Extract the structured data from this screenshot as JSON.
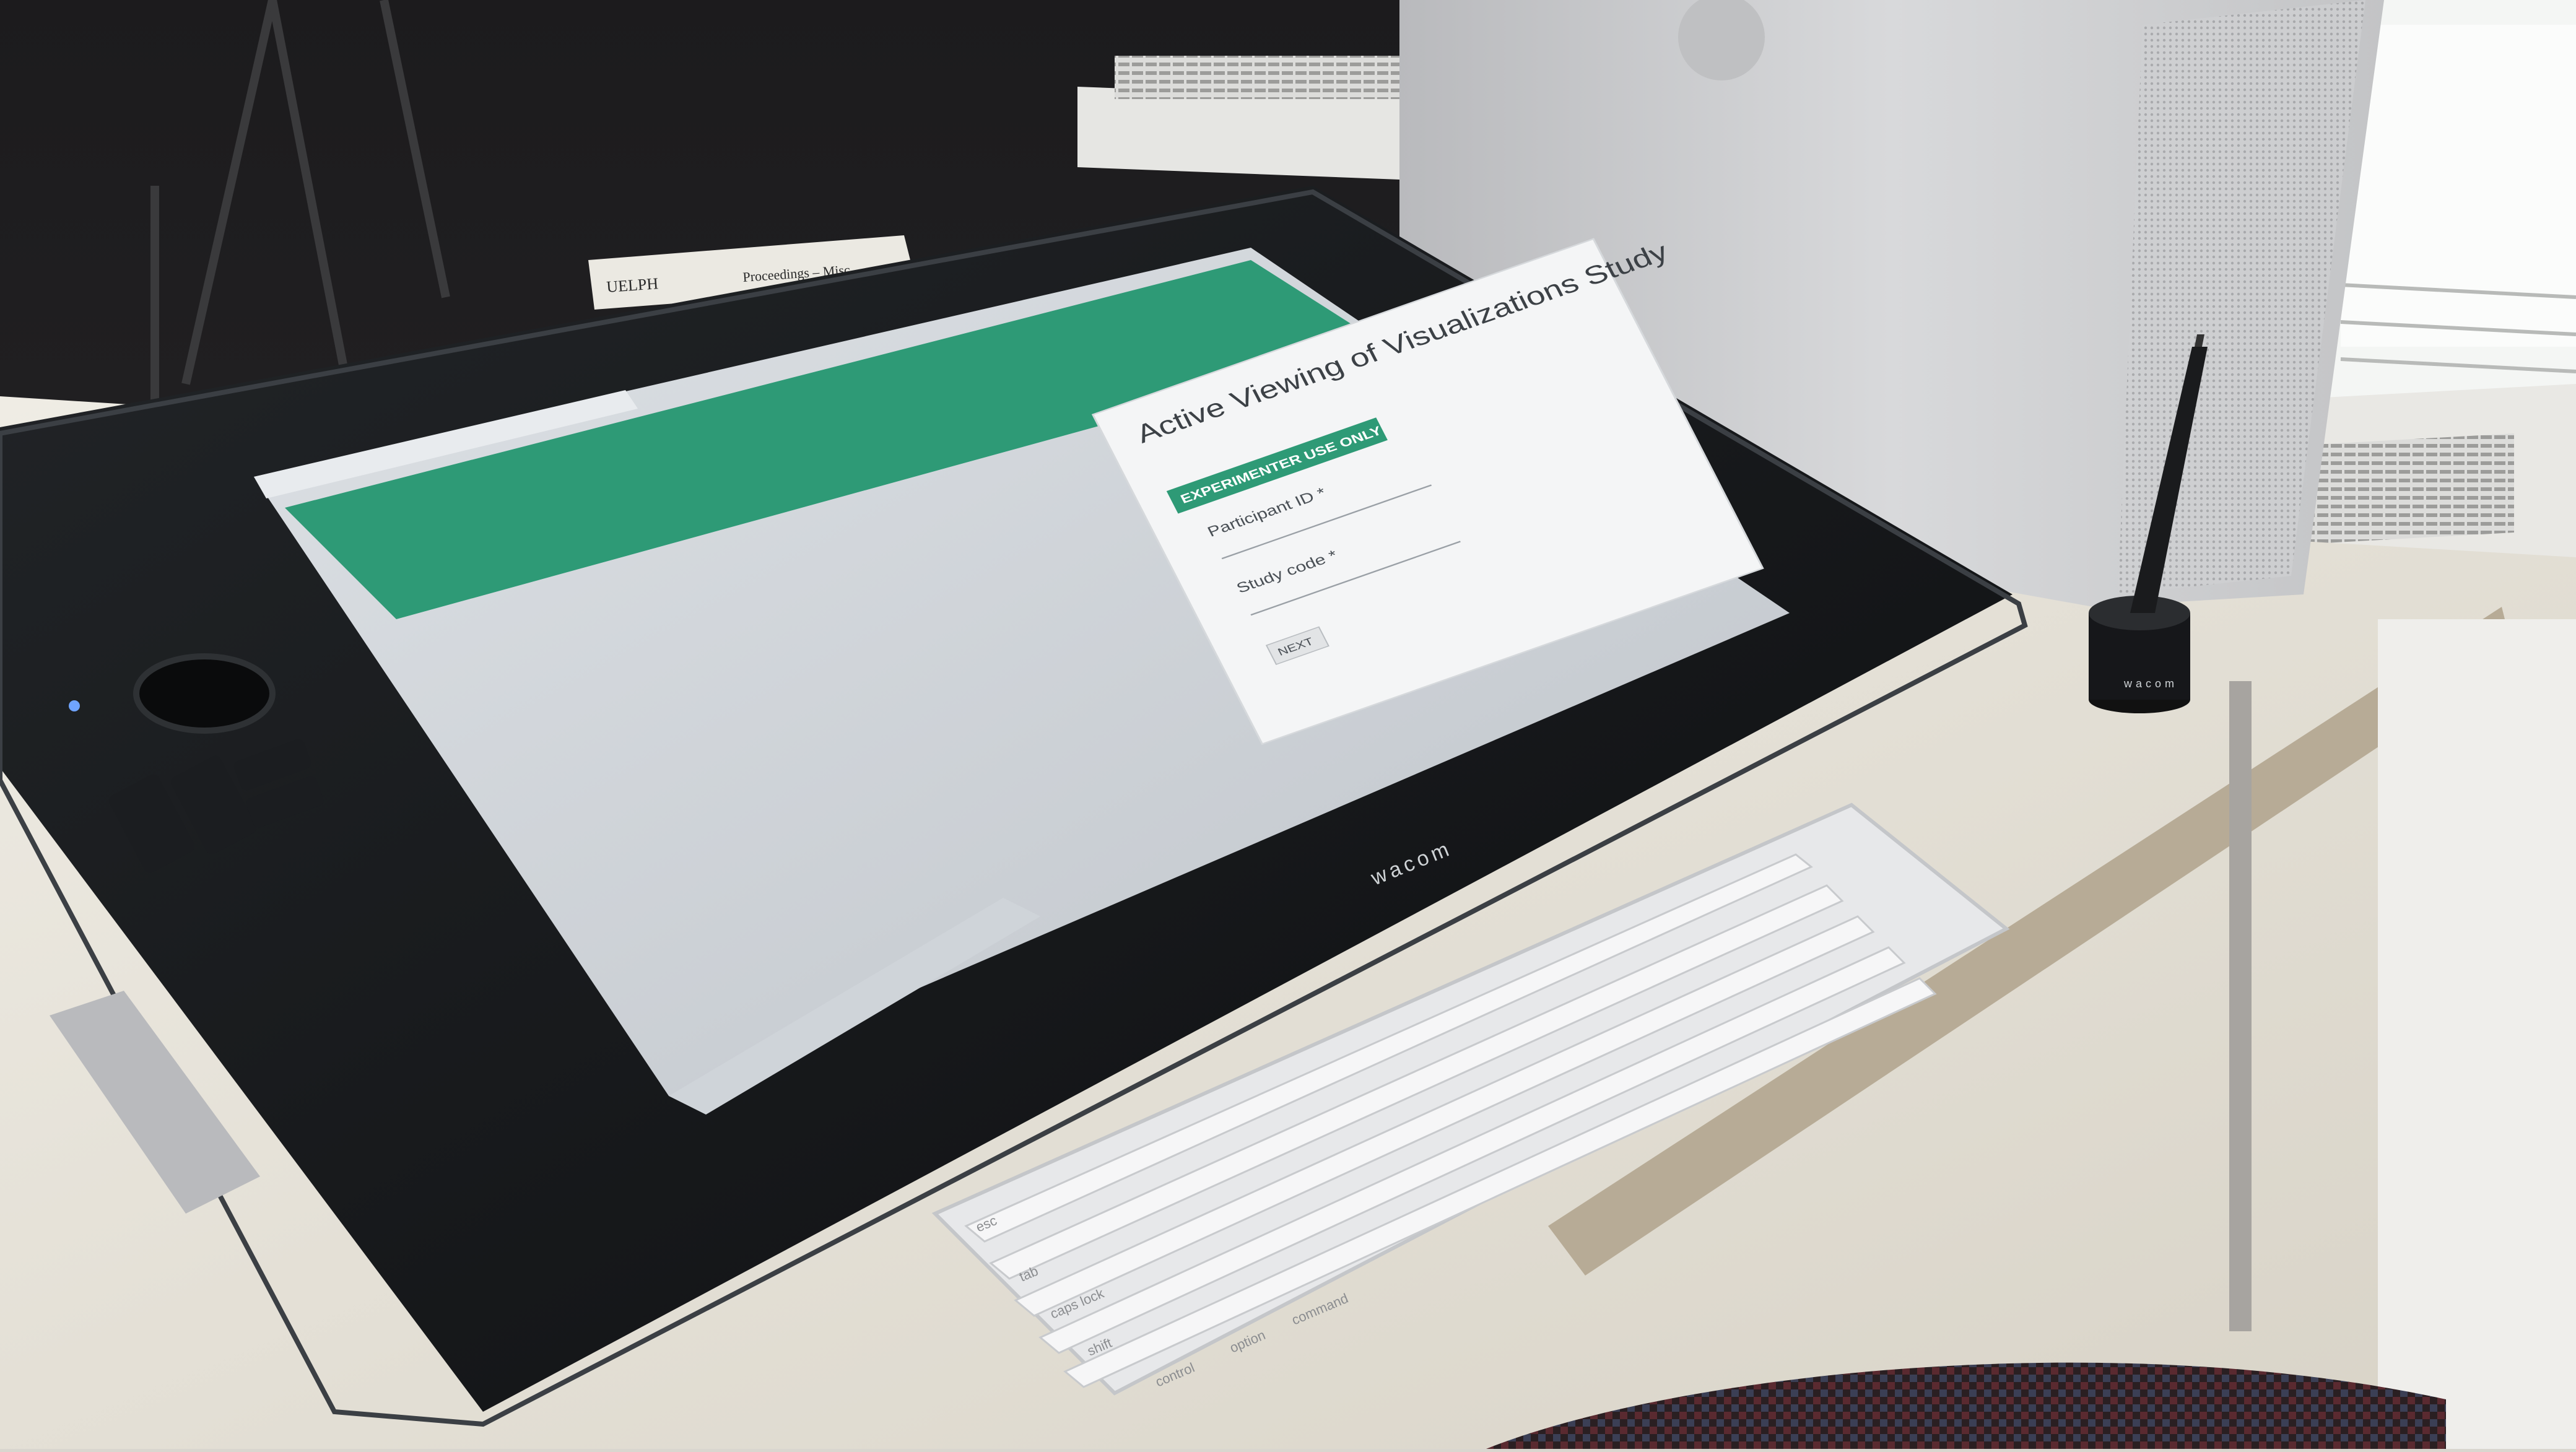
{
  "scene": {
    "description_free": true,
    "shelf": {
      "binder_labels": [
        "UELPH",
        "Proceedings – Misc"
      ]
    },
    "tablet": {
      "brand": "wacom",
      "screen": {
        "form": {
          "title": "Active Viewing of Visualizations Study",
          "badge": "EXPERIMENTER USE ONLY",
          "fields": [
            {
              "label": "Participant ID *"
            },
            {
              "label": "Study code *"
            }
          ],
          "next_button": "NEXT"
        }
      }
    },
    "pen_stand": {
      "brand": "wacom"
    },
    "keyboard": {
      "keys": [
        "caps lock",
        "shift",
        "control",
        "option",
        "command",
        "tab",
        "esc"
      ]
    }
  },
  "colors": {
    "form_header_green": "#2e9a76",
    "screen_background": "#cbd0d6",
    "tablet_bezel": "#141618",
    "desk": "#e4e0d6",
    "computer_case": "#c9cacc",
    "keyboard": "#ecedee",
    "chair": "#2a1f22"
  }
}
